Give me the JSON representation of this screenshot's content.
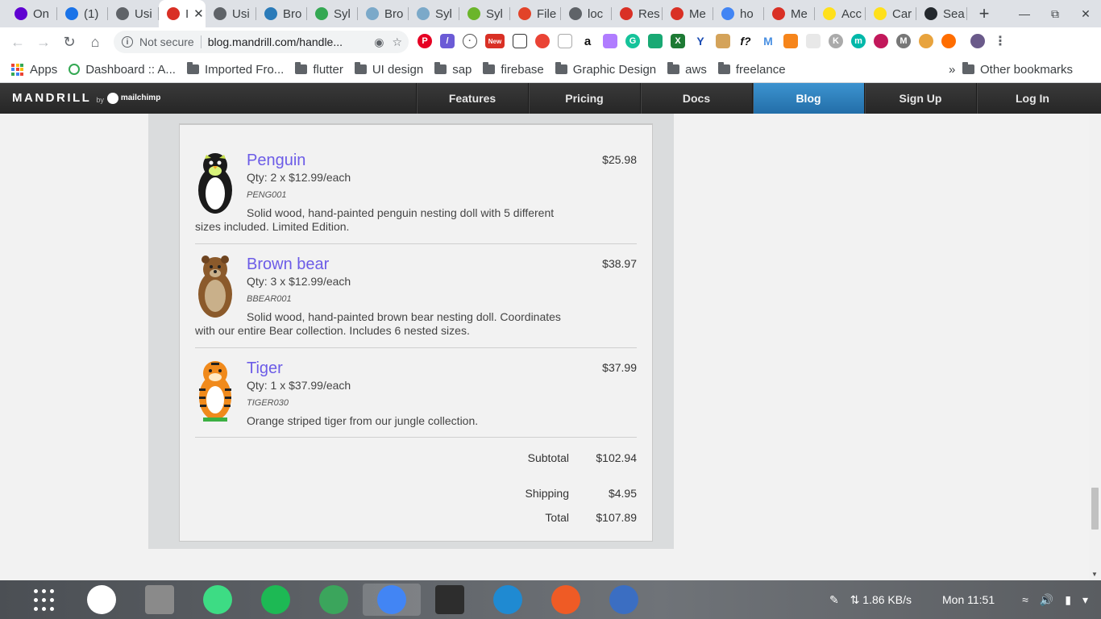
{
  "browser": {
    "tabs": [
      {
        "label": "On",
        "icon": "yahoo-icon",
        "color": "#5f01d1"
      },
      {
        "label": "(1)",
        "icon": "chat-icon",
        "color": "#1a73e8"
      },
      {
        "label": "Usi",
        "icon": "globe-icon",
        "color": "#5f6368"
      },
      {
        "label": "I",
        "icon": "gmail-icon",
        "color": "#d93025",
        "active": true
      },
      {
        "label": "Usi",
        "icon": "globe-icon",
        "color": "#5f6368"
      },
      {
        "label": "Bro",
        "icon": "house-icon",
        "color": "#2b7bb9"
      },
      {
        "label": "Syl",
        "icon": "s-icon",
        "color": "#34a853"
      },
      {
        "label": "Bro",
        "icon": "house-icon",
        "color": "#7ba9c9"
      },
      {
        "label": "Syl",
        "icon": "house-icon",
        "color": "#7ba9c9"
      },
      {
        "label": "Syl",
        "icon": "circle-icon",
        "color": "#6bb52b"
      },
      {
        "label": "File",
        "icon": "gitlab-icon",
        "color": "#e24329"
      },
      {
        "label": "loc",
        "icon": "globe-icon",
        "color": "#5f6368"
      },
      {
        "label": "Res",
        "icon": "gmail-icon",
        "color": "#d93025"
      },
      {
        "label": "Me",
        "icon": "gmail-icon",
        "color": "#d93025"
      },
      {
        "label": "ho",
        "icon": "google-icon",
        "color": "#4285f4"
      },
      {
        "label": "Me",
        "icon": "gmail-icon",
        "color": "#d93025"
      },
      {
        "label": "Acc",
        "icon": "mailchimp-icon",
        "color": "#ffe01b"
      },
      {
        "label": "Car",
        "icon": "mailchimp-icon",
        "color": "#ffe01b"
      },
      {
        "label": "Sea",
        "icon": "github-icon",
        "color": "#24292e"
      }
    ],
    "new_tab": "+",
    "window_controls": {
      "minimize": "—",
      "restore": "⧉",
      "close": "✕"
    },
    "url_security": "Not secure",
    "url": "blog.mandrill.com/handle...",
    "extension_badge_new": "New"
  },
  "bookmarks": {
    "apps": "Apps",
    "items": [
      {
        "label": "Dashboard :: A...",
        "type": "site"
      },
      {
        "label": "Imported Fro...",
        "type": "folder"
      },
      {
        "label": "flutter",
        "type": "folder"
      },
      {
        "label": "UI design",
        "type": "folder"
      },
      {
        "label": "sap",
        "type": "folder"
      },
      {
        "label": "firebase",
        "type": "folder"
      },
      {
        "label": "Graphic Design",
        "type": "folder"
      },
      {
        "label": "aws",
        "type": "folder"
      },
      {
        "label": "freelance",
        "type": "folder"
      }
    ],
    "overflow": "»",
    "other": "Other bookmarks"
  },
  "site": {
    "logo": "MANDRILL",
    "logo_by": "by",
    "logo_mailchimp": "mailchimp",
    "nav": [
      {
        "label": "Features"
      },
      {
        "label": "Pricing"
      },
      {
        "label": "Docs"
      },
      {
        "label": "Blog",
        "active": true
      },
      {
        "label": "Sign Up"
      },
      {
        "label": "Log In"
      }
    ]
  },
  "order": {
    "items": [
      {
        "name": "Penguin",
        "qty": "Qty: 2 x $12.99/each",
        "sku": "PENG001",
        "description": "Solid wood, hand-painted penguin nesting doll with 5 different sizes included. Limited Edition.",
        "price": "$25.98",
        "icon": "penguin-doll-icon"
      },
      {
        "name": "Brown bear",
        "qty": "Qty: 3 x $12.99/each",
        "sku": "BBEAR001",
        "description": "Solid wood, hand-painted brown bear nesting doll. Coordinates with our entire Bear collection. Includes 6 nested sizes.",
        "price": "$38.97",
        "icon": "bear-doll-icon"
      },
      {
        "name": "Tiger",
        "qty": "Qty: 1 x $37.99/each",
        "sku": "TIGER030",
        "description": "Orange striped tiger from our jungle collection.",
        "price": "$37.99",
        "icon": "tiger-doll-icon"
      }
    ],
    "subtotal_label": "Subtotal",
    "subtotal": "$102.94",
    "shipping_label": "Shipping",
    "shipping": "$4.95",
    "total_label": "Total",
    "total": "$107.89"
  },
  "taskbar": {
    "apps": [
      {
        "name": "app-grid-icon"
      },
      {
        "name": "mongodb-compass-icon",
        "color": "#ffffff"
      },
      {
        "name": "files-icon",
        "color": "#8a8a8a"
      },
      {
        "name": "android-studio-icon",
        "color": "#3ddc84"
      },
      {
        "name": "spotify-icon",
        "color": "#1db954"
      },
      {
        "name": "rocket-icon",
        "color": "#3ba55c"
      },
      {
        "name": "chrome-icon",
        "color": "#4285f4",
        "active": true
      },
      {
        "name": "terminal-icon",
        "color": "#2d2d2d"
      },
      {
        "name": "vscode-icon",
        "color": "#1f8ad2"
      },
      {
        "name": "postman-icon",
        "color": "#ef5b25"
      },
      {
        "name": "network-tool-icon",
        "color": "#3b6ec2"
      }
    ],
    "net_speed": "1.86 KB/s",
    "clock": "Mon 11:51"
  }
}
